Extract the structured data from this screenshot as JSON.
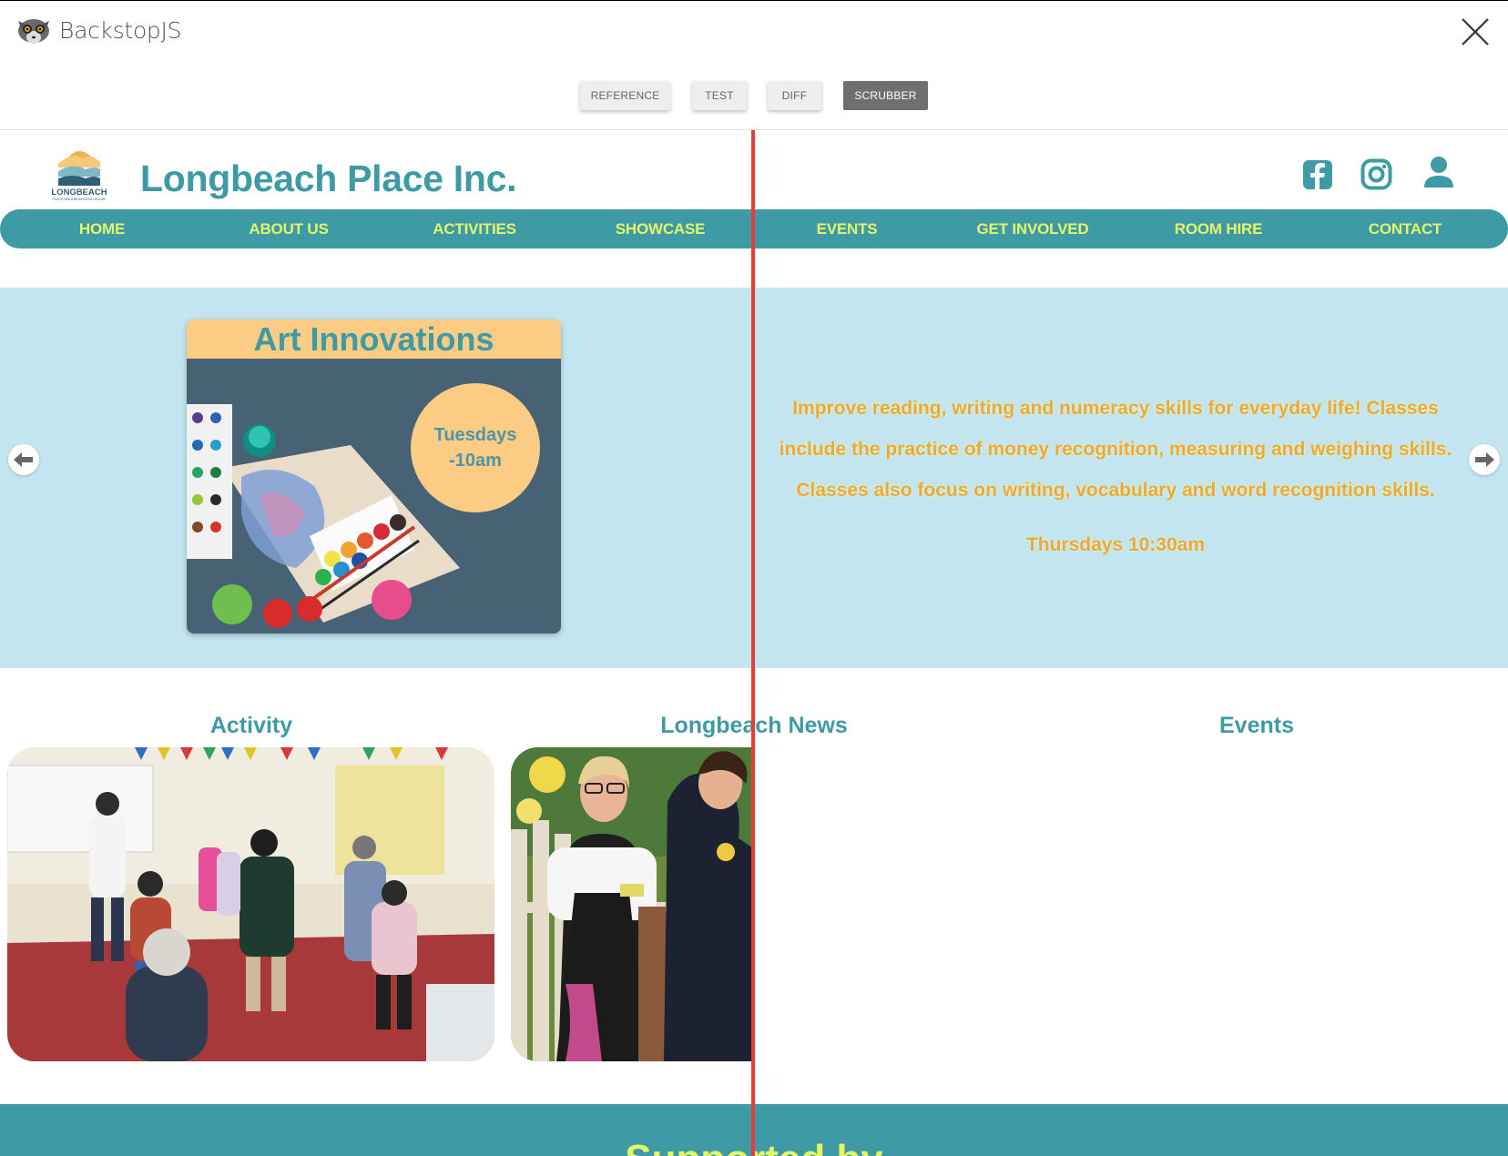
{
  "backstop": {
    "app_title": "BackstopJS",
    "tabs": [
      "REFERENCE",
      "TEST",
      "DIFF",
      "SCRUBBER"
    ],
    "active_tab": "SCRUBBER"
  },
  "site": {
    "logo_text": "LONGBEACH",
    "logo_subtext": "PLACE NEIGHBOURHOOD HOUSE",
    "title": "Longbeach Place Inc.",
    "social_icons": [
      "facebook-icon",
      "instagram-icon",
      "user-icon"
    ],
    "nav": [
      "HOME",
      "ABOUT US",
      "ACTIVITIES",
      "SHOWCASE",
      "EVENTS",
      "GET INVOLVED",
      "ROOM HIRE",
      "CONTACT"
    ]
  },
  "hero": {
    "card_title": "Art Innovations",
    "badge_line1": "Tuesdays",
    "badge_line2": "-10am",
    "text": "Improve reading, writing and numeracy skills for everyday life! Classes include the practice of money recognition, measuring and weighing skills. Classes also focus on writing, vocabulary and word recognition skills.",
    "time": "Thursdays 10:30am"
  },
  "sections": {
    "activity": "Activity",
    "news": "Longbeach News",
    "events": "Events"
  },
  "footer": {
    "title": "Supported by"
  },
  "colors": {
    "brand_teal": "#3e9aa5",
    "nav_text": "#e4f56a",
    "hero_bg": "#c2e5ef",
    "card_accent": "#fccc85",
    "hero_text": "#e9a848",
    "scrubber_line": "#ea3b3b"
  }
}
